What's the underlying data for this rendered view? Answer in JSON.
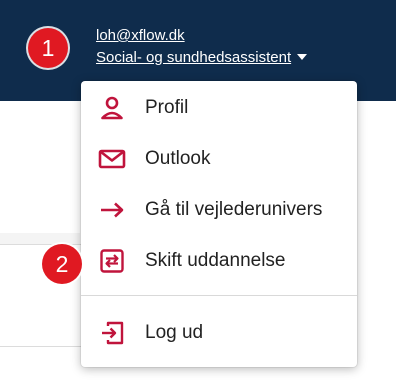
{
  "header": {
    "email": "loh@xflow.dk",
    "role": "Social- og sundhedsassistent",
    "background_color": "#0f2c4c"
  },
  "markers": [
    "1",
    "2"
  ],
  "menu": {
    "accent_color": "#c0143c",
    "items": [
      {
        "label": "Profil",
        "icon": "person-icon"
      },
      {
        "label": "Outlook",
        "icon": "mail-icon"
      },
      {
        "label": "Gå til vejlederunivers",
        "icon": "arrow-right-icon"
      },
      {
        "label": "Skift uddannelse",
        "icon": "switch-icon"
      }
    ],
    "logout": {
      "label": "Log ud",
      "icon": "logout-icon"
    }
  }
}
